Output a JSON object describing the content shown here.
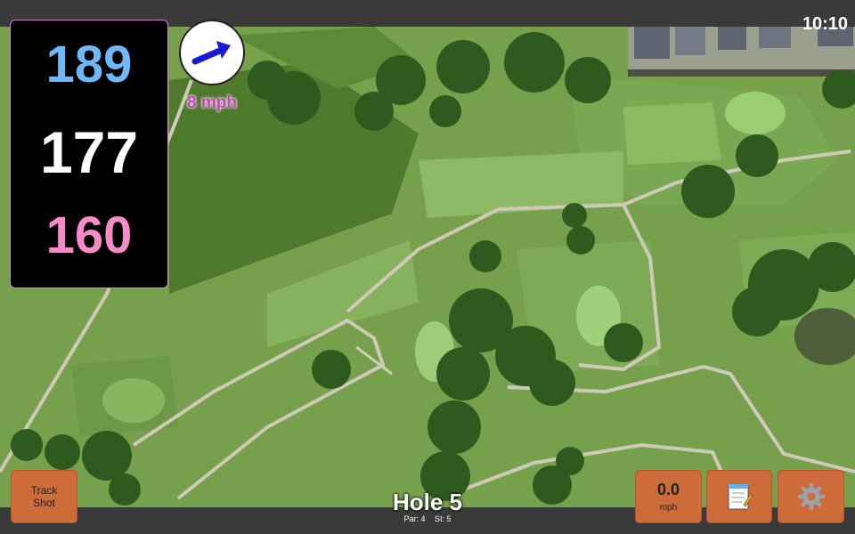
{
  "colors": {
    "back_distance": "#6fb8f7",
    "middle_distance": "#ffffff",
    "front_distance": "#f78ac8",
    "wind_arrow": "#1a1ad6",
    "button": "#cd6b3b",
    "wind_text": "#cc3fbb"
  },
  "status": {
    "clock": "10:10"
  },
  "distances": {
    "back": "189",
    "middle": "177",
    "front": "160"
  },
  "wind": {
    "label": "8 mph",
    "icon": "wind-arrow-icon"
  },
  "buttons": {
    "track_line1": "Track",
    "track_line2": "Shot",
    "speed_value": "0.0",
    "speed_unit": "mph",
    "notes_icon": "notepad-icon",
    "settings_icon": "gear-icon"
  },
  "hole": {
    "title": "Hole 5",
    "par": "Par: 4",
    "si": "SI: 5"
  }
}
